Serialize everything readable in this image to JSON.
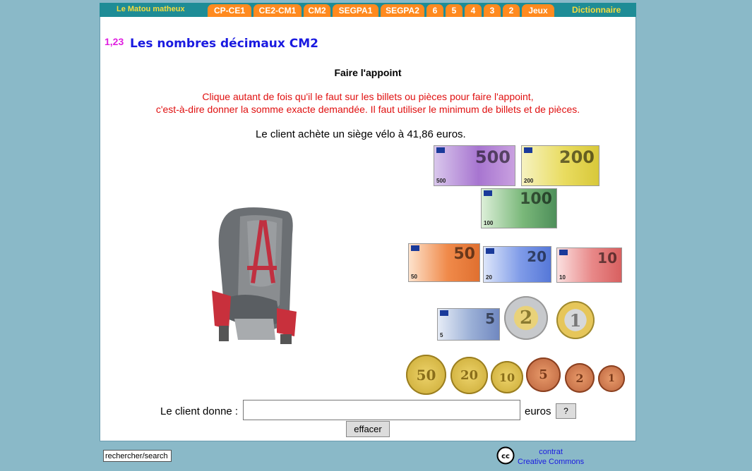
{
  "nav": {
    "brand": "Le Matou matheux",
    "tabs": [
      "CP-CE1",
      "CE2-CM1",
      "CM2",
      "SEGPA1",
      "SEGPA2",
      "6",
      "5",
      "4",
      "3",
      "2",
      "Jeux"
    ],
    "dictionary": "Dictionnaire"
  },
  "header": {
    "logo_text": "1,23",
    "title": "Les nombres décimaux CM2"
  },
  "exercise": {
    "title": "Faire l'appoint",
    "instruction_line1": "Clique autant de fois qu'il le faut sur les billets ou pièces pour faire l'appoint,",
    "instruction_line2": "c'est-à-dire donner la somme exacte demandée. Il faut utiliser le minimum de billets et de pièces.",
    "question": "Le client achète un siège vélo à 41,86 euros.",
    "product": "siège vélo",
    "price": "41,86"
  },
  "money": {
    "notes": [
      {
        "id": "500",
        "label": "500",
        "color": "#b07ad0"
      },
      {
        "id": "200",
        "label": "200",
        "color": "#e8e070"
      },
      {
        "id": "100",
        "label": "100",
        "color": "#7cc07c"
      },
      {
        "id": "50",
        "label": "50",
        "color": "#f0905a"
      },
      {
        "id": "20",
        "label": "20",
        "color": "#7c9ce8"
      },
      {
        "id": "10",
        "label": "10",
        "color": "#e88888"
      },
      {
        "id": "5",
        "label": "5",
        "color": "#8ea8d8"
      }
    ],
    "coins": [
      {
        "id": "2e",
        "label": "2"
      },
      {
        "id": "1e",
        "label": "1"
      },
      {
        "id": "50c",
        "label": "50"
      },
      {
        "id": "20c",
        "label": "20"
      },
      {
        "id": "10c",
        "label": "10"
      },
      {
        "id": "5c",
        "label": "5"
      },
      {
        "id": "2c",
        "label": "2"
      },
      {
        "id": "1c",
        "label": "1"
      }
    ]
  },
  "form": {
    "give_label": "Le client donne :",
    "amount_value": "",
    "currency_label": "euros",
    "help_label": "?",
    "clear_label": "effacer"
  },
  "footer": {
    "search_value": "rechercher/search",
    "cc_icon_text": "cc",
    "cc_line1": "contrat",
    "cc_line2": "Creative Commons"
  }
}
